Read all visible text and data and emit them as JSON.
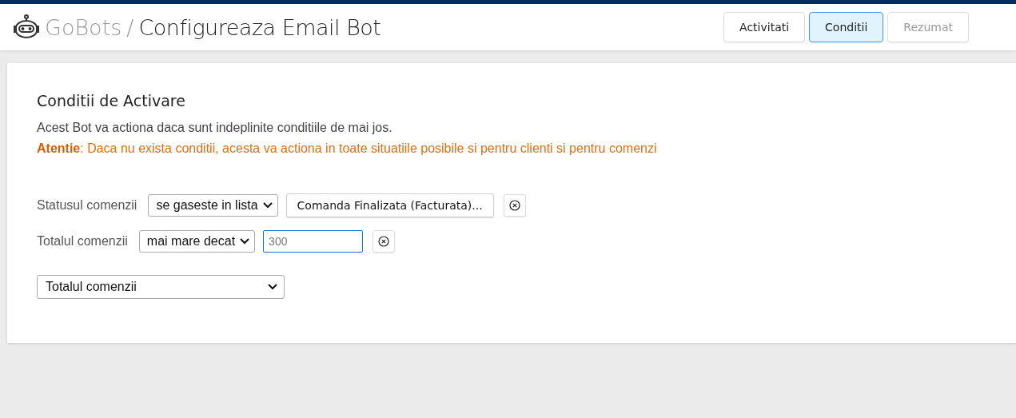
{
  "header": {
    "brand": "GoBots",
    "separator": "/",
    "title": "Configureaza Email Bot"
  },
  "steps": [
    {
      "label": "Activitati",
      "selected": false,
      "disabled": false
    },
    {
      "label": "Conditii",
      "selected": true,
      "disabled": false
    },
    {
      "label": "Rezumat",
      "selected": false,
      "disabled": true
    }
  ],
  "section": {
    "title": "Conditii de Activare",
    "description": "Acest Bot va actiona daca sunt indeplinite conditiile de mai jos.",
    "warning": "**Atentie**: Daca nu exista conditii, acesta va actiona in toate situatiile posibile si pentru clienti si pentru comenzi"
  },
  "conditions": [
    {
      "kind": "list",
      "label": "Statusul comenzii",
      "operator": "se gaseste in lista",
      "value": "Comanda Finalizata (Facturata)..."
    },
    {
      "kind": "input",
      "label": "Totalul comenzii",
      "operator": "mai mare decat",
      "placeholder": "300",
      "focused": true
    }
  ],
  "add_condition": {
    "value": "Totalul comenzii"
  }
}
